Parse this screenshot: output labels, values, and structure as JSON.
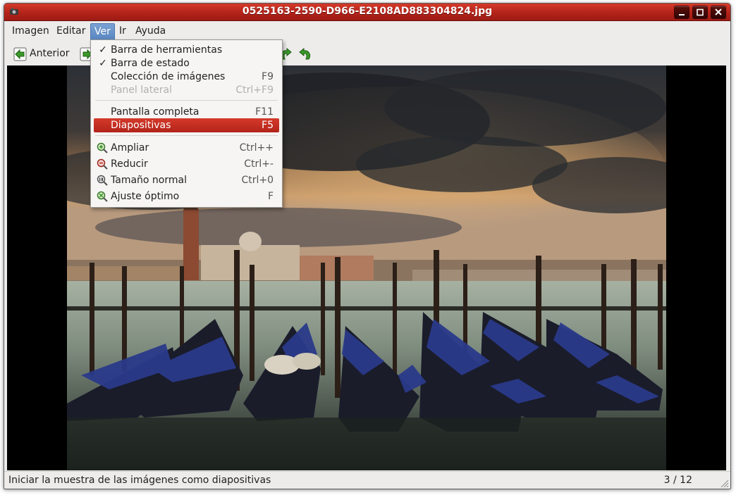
{
  "window": {
    "title": "0525163-2590-D966-E2108AD883304824.jpg",
    "icons": {
      "app": "eye-of-gnome-icon",
      "minimize": "minimize-icon",
      "maximize": "maximize-icon",
      "close": "close-icon"
    }
  },
  "menubar": {
    "items": [
      {
        "label": "Imagen"
      },
      {
        "label": "Editar"
      },
      {
        "label": "Ver",
        "active": true
      },
      {
        "label": "Ir"
      },
      {
        "label": "Ayuda"
      }
    ]
  },
  "toolbar": {
    "previous_label": "Anterior",
    "icons": [
      "go-previous-icon",
      "go-next-icon",
      "rotate-left-icon",
      "rotate-right-icon"
    ]
  },
  "view_menu": {
    "items": [
      {
        "label": "Barra de herramientas",
        "shortcut": "",
        "checked": true
      },
      {
        "label": "Barra de estado",
        "shortcut": "",
        "checked": true
      },
      {
        "label": "Colección de imágenes",
        "shortcut": "F9"
      },
      {
        "label": "Panel lateral",
        "shortcut": "Ctrl+F9",
        "disabled": true
      },
      {
        "label": "Pantalla completa",
        "shortcut": "F11"
      },
      {
        "label": "Diapositivas",
        "shortcut": "F5",
        "highlighted": true
      },
      {
        "label": "Ampliar",
        "shortcut": "Ctrl++",
        "icon": "zoom-in-icon"
      },
      {
        "label": "Reducir",
        "shortcut": "Ctrl+-",
        "icon": "zoom-out-icon"
      },
      {
        "label": "Tamaño normal",
        "shortcut": "Ctrl+0",
        "icon": "zoom-original-icon"
      },
      {
        "label": "Ajuste óptimo",
        "shortcut": "F",
        "icon": "zoom-fit-icon"
      }
    ]
  },
  "statusbar": {
    "message": "Iniciar la muestra de las imágenes como diapositivas",
    "position": "3 / 12"
  },
  "colors": {
    "titlebar": "#b3231a",
    "menu_highlight": "#c42e22",
    "menu_active": "#6b94cb"
  }
}
